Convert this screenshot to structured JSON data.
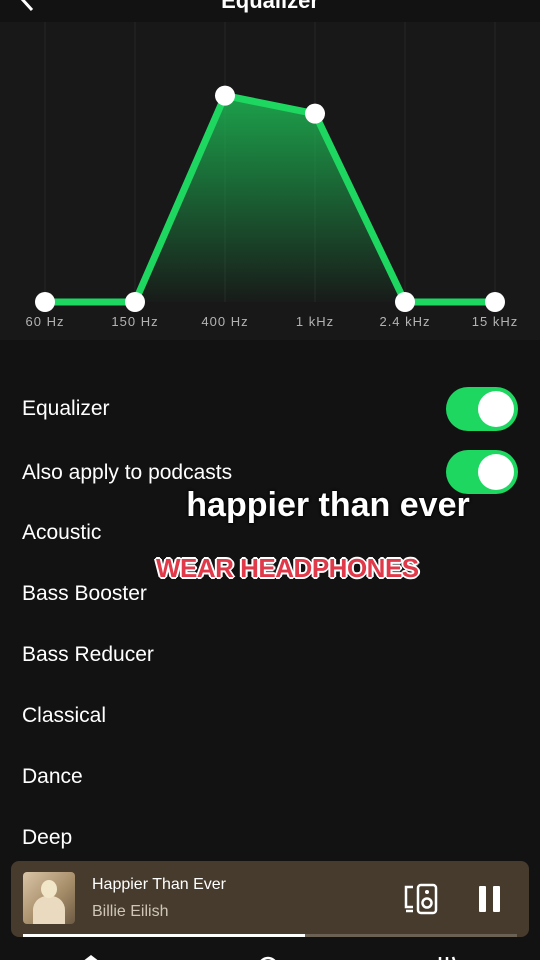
{
  "header": {
    "title": "Equalizer",
    "back_icon": "chevron-left-icon"
  },
  "equalizer": {
    "bands": [
      {
        "label": "60 Hz",
        "level": 0.0
      },
      {
        "label": "150 Hz",
        "level": 0.0
      },
      {
        "label": "400 Hz",
        "level": 0.8
      },
      {
        "label": "1 kHz",
        "level": 0.73
      },
      {
        "label": "2.4 kHz",
        "level": 0.0
      },
      {
        "label": "15 kHz",
        "level": 0.0
      }
    ],
    "line_color": "#1ed760",
    "fill_color": "#1db954"
  },
  "settings": {
    "equalizer_label": "Equalizer",
    "equalizer_on": true,
    "podcasts_label": "Also apply to podcasts",
    "podcasts_on": true
  },
  "presets": [
    "Acoustic",
    "Bass Booster",
    "Bass Reducer",
    "Classical",
    "Dance",
    "Deep"
  ],
  "overlay": {
    "title": "happier than ever",
    "subtitle": "WEAR HEADPHONES",
    "subtitle_color": "#e03a4a"
  },
  "now_playing": {
    "title": "Happier Than Ever",
    "artist": "Billie Eilish",
    "progress": 0.57,
    "bg_color": "#463b2d",
    "device_icon": "connect-device-icon",
    "pause_icon": "pause-icon"
  },
  "nav": [
    "home-icon",
    "search-icon",
    "library-icon"
  ]
}
